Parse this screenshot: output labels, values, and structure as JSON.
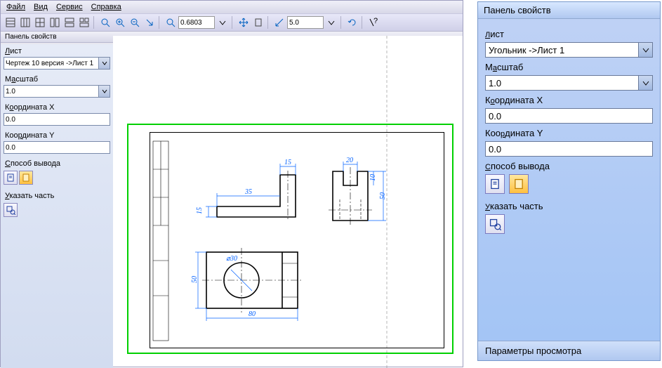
{
  "menu": {
    "file": "Файл",
    "view": "Вид",
    "service": "Сервис",
    "help": "Справка"
  },
  "toolbar": {
    "zoom_value": "0.6803",
    "scale_value": "5.0"
  },
  "panel_title": "Панель свойств",
  "left": {
    "list_label": "Лист",
    "list_value": "Чертеж 10 версия ->Лист 1",
    "scale_label": "Масштаб",
    "scale_value": "1.0",
    "x_label": "Координата Х",
    "x_value": "0.0",
    "y_label": "Координата Y",
    "y_value": "0.0",
    "output_label": "Способ вывода",
    "part_label": "Указать часть"
  },
  "right": {
    "header": "Панель свойств",
    "list_label": "Лист",
    "list_value": "Угольник ->Лист 1",
    "scale_label": "Масштаб",
    "scale_value": "1.0",
    "x_label": "Координата Х",
    "x_value": "0.0",
    "y_label": "Координата Y",
    "y_value": "0.0",
    "output_label": "Способ вывода",
    "part_label": "Указать часть",
    "tab": "Параметры просмотра"
  },
  "drawing": {
    "dims": {
      "d15": "15",
      "d15v": "15",
      "d50": "50",
      "d35": "35",
      "d20": "20",
      "d10": "10",
      "d50r": "50",
      "d80": "80",
      "diam30": "⌀30"
    }
  }
}
